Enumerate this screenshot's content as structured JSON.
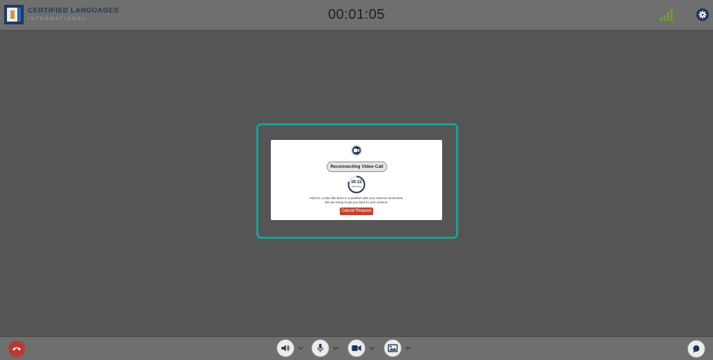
{
  "header": {
    "brand_title": "CERTIFIED LANGUAGES",
    "brand_subtitle": "INTERNATIONAL",
    "call_timer": "00:01:05",
    "signal_icon": "signal-strength-icon",
    "settings_icon": "gear-icon"
  },
  "dialog": {
    "camera_icon": "video-camera-icon",
    "status_label": "Reconnecting Video Call",
    "countdown_time": "00:22",
    "countdown_unit": "minutes",
    "message": "Hold on. Looks like there is a problem with your internet connection. We are trying to get you back to your session.",
    "cancel_label": "Cancel Request",
    "highlight_color": "#1aa197",
    "cancel_color": "#c0432f"
  },
  "footer": {
    "end_call_icon": "hang-up-icon",
    "controls": [
      {
        "name": "speaker",
        "icon": "speaker-icon"
      },
      {
        "name": "microphone",
        "icon": "microphone-icon"
      },
      {
        "name": "camera",
        "icon": "video-camera-icon"
      },
      {
        "name": "background",
        "icon": "image-icon"
      }
    ],
    "chat_icon": "chat-icon",
    "end_call_color": "#b73a33"
  }
}
